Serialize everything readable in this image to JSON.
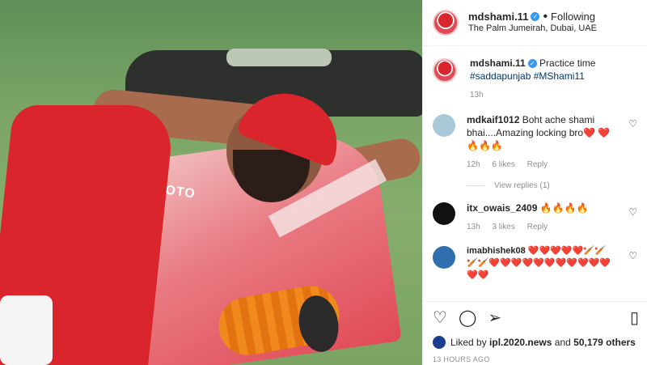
{
  "post": {
    "username": "mdshami.11",
    "following_label": "Following",
    "location": "The Palm Jumeirah, Dubai, UAE",
    "jersey_text": "MOTO"
  },
  "caption": {
    "username": "mdshami.11",
    "text": "Practice time",
    "hashtags": "#saddapunjab #MShami11",
    "time": "13h"
  },
  "comments": [
    {
      "username": "mdkaif1012",
      "text": "Boht ache shami bhai....Amazing locking bro❤️ ❤️ 🔥🔥🔥",
      "time": "12h",
      "likes": "6 likes",
      "reply": "Reply",
      "avatar_color": "#a9c9d9"
    },
    {
      "username": "itx_owais_2409",
      "text": "🔥🔥🔥🔥",
      "time": "13h",
      "likes": "3 likes",
      "reply": "Reply",
      "avatar_color": "#111111"
    },
    {
      "username": "imabhishek08",
      "text": "❤️❤️❤️❤️❤️🏏🏏🏏🏏❤️❤️❤️❤️❤️❤️❤️❤️❤️❤️❤️❤️❤️",
      "time": "",
      "likes": "",
      "reply": "",
      "avatar_color": "#2f6fb0"
    }
  ],
  "view_replies": "View replies (1)",
  "likes": {
    "liked_by_prefix": "Liked by",
    "liked_by_user": "ipl.2020.news",
    "and": "and",
    "others": "50,179 others"
  },
  "timestamp": "13 HOURS AGO",
  "icons": {
    "like": "heart-icon",
    "comment": "comment-icon",
    "share": "share-icon",
    "save": "bookmark-icon"
  }
}
